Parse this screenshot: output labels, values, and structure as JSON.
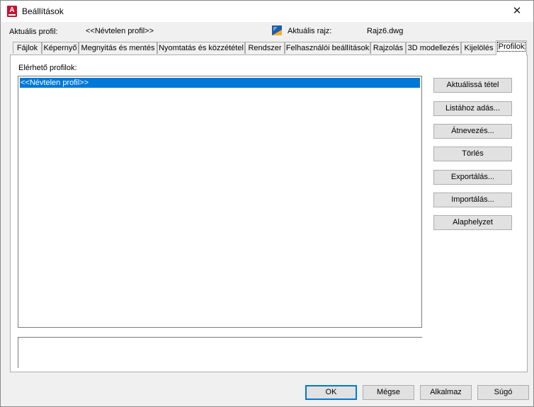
{
  "window": {
    "title": "Beállítások",
    "close": "✕"
  },
  "header": {
    "current_profile_label": "Aktuális profil:",
    "current_profile_value": "<<Névtelen profil>>",
    "current_drawing_label": "Aktuális rajz:",
    "current_drawing_value": "Rajz6.dwg"
  },
  "tabs": [
    "Fájlok",
    "Képernyő",
    "Megnyitás és mentés",
    "Nyomtatás és közzététel",
    "Rendszer",
    "Felhasználói beállítások",
    "Rajzolás",
    "3D modellezés",
    "Kijelölés",
    "Profilok"
  ],
  "active_tab": "Profilok",
  "profiles": {
    "label": "Elérhető profilok:",
    "items": [
      "<<Névtelen profil>>"
    ],
    "selected": "<<Névtelen profil>>"
  },
  "side_buttons": {
    "set_current": "Aktuálissá tétel",
    "add_to_list": "Listához adás...",
    "rename": "Átnevezés...",
    "delete": "Törlés",
    "export": "Exportálás...",
    "import": "Importálás...",
    "reset": "Alaphelyzet"
  },
  "footer": {
    "ok": "OK",
    "cancel": "Mégse",
    "apply": "Alkalmaz",
    "help": "Súgó"
  },
  "colors": {
    "selection": "#0078d7",
    "app_icon": "#c8102e"
  },
  "icons": {
    "app": "autocad-app-icon",
    "drawing": "dwg-file-icon",
    "close": "close-icon"
  }
}
